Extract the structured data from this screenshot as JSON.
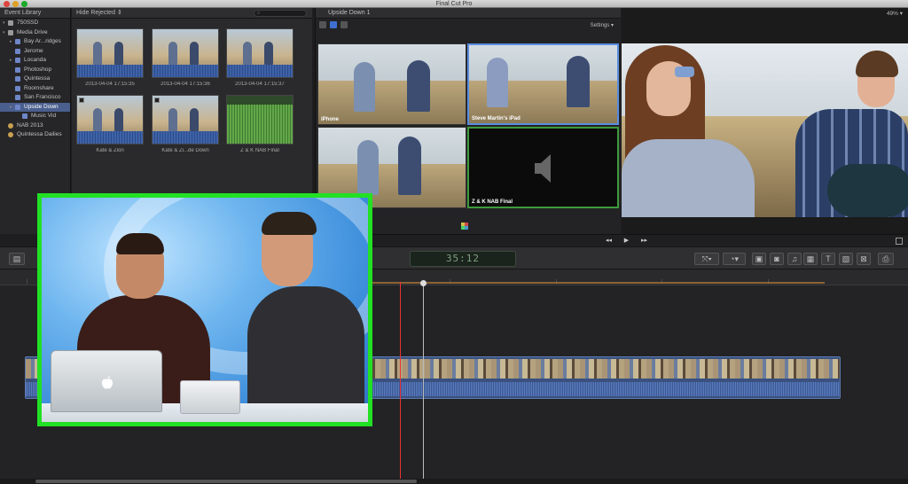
{
  "window": {
    "title": "Final Cut Pro"
  },
  "library": {
    "header": "Event Library",
    "items": [
      {
        "label": "750SSD",
        "kind": "drive",
        "indent": 0,
        "expanded": true
      },
      {
        "label": "Media Drive",
        "kind": "drive",
        "indent": 0,
        "expanded": true
      },
      {
        "label": "Bay Ar...ridges",
        "kind": "event",
        "indent": 1
      },
      {
        "label": "Jerome",
        "kind": "event",
        "indent": 1
      },
      {
        "label": "Locanda",
        "kind": "event",
        "indent": 1
      },
      {
        "label": "Photoshop",
        "kind": "event",
        "indent": 1
      },
      {
        "label": "Quintessa",
        "kind": "event",
        "indent": 1
      },
      {
        "label": "Roomshare",
        "kind": "event",
        "indent": 1
      },
      {
        "label": "San Francisco",
        "kind": "event",
        "indent": 1
      },
      {
        "label": "Upside Down",
        "kind": "event",
        "indent": 1,
        "selected": true
      },
      {
        "label": "Music Vid",
        "kind": "event",
        "indent": 2
      },
      {
        "label": "NAB 2013",
        "kind": "star",
        "indent": 0
      },
      {
        "label": "Quintessa Dailies",
        "kind": "star",
        "indent": 0
      }
    ]
  },
  "browser": {
    "filter": "Hide Rejected",
    "clips": [
      {
        "label": "2013-04-04 17:15:35"
      },
      {
        "label": "2013-04-04 17:15:36"
      },
      {
        "label": "2013-04-04 17:15:37"
      },
      {
        "label": "Kate & Zion"
      },
      {
        "label": "Kate & Zi...de Down"
      },
      {
        "label": "Z & K NAB Final"
      }
    ]
  },
  "angle_viewer": {
    "title": "Upside Down 1",
    "settings_label": "Settings",
    "angles": [
      {
        "caption": "iPhone"
      },
      {
        "caption": "Steve Martin's iPad"
      },
      {
        "caption": ""
      },
      {
        "caption": "Z & K NAB Final"
      }
    ]
  },
  "viewer": {
    "zoom": "49%"
  },
  "toolbar": {
    "timecode": "35:12"
  },
  "colors": {
    "pip_border": "#22e024",
    "selection": "#4a5f8e",
    "clip": "#3a517f",
    "playhead": "#ee3333"
  }
}
